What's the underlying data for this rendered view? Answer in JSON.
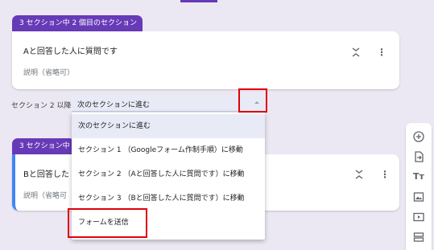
{
  "section2": {
    "tab_label": "3 セクション中 2 個目のセクション",
    "title": "Aと回答した人に質問です",
    "description": "説明（省略可）"
  },
  "navigation": {
    "after_label": "セクション 2 以降",
    "selected_value": "次のセクションに進む"
  },
  "menu": {
    "items": [
      "次のセクションに進む",
      "セクション 1 （Googleフォーム作制手順）に移動",
      "セクション 2 （Aと回答した人に質問です）に移動",
      "セクション 3 （Bと回答した人に質問です）に移動",
      "フォームを送信"
    ]
  },
  "section3": {
    "tab_label": "3 セクション中",
    "title": "Bと回答した",
    "description": "説明（省略可"
  },
  "icons": {
    "collapse": "collapse-icon",
    "more": "more-vert-icon",
    "add": "add-question-icon",
    "import": "import-questions-icon",
    "title": "add-title-icon",
    "image": "add-image-icon",
    "video": "add-video-icon",
    "section": "add-section-icon"
  },
  "colors": {
    "accent": "#673ab7",
    "background": "#ece8f3",
    "highlight": "#e0000b",
    "selected_bg": "#e8eaf6",
    "section_left_border": "#4285f4"
  }
}
